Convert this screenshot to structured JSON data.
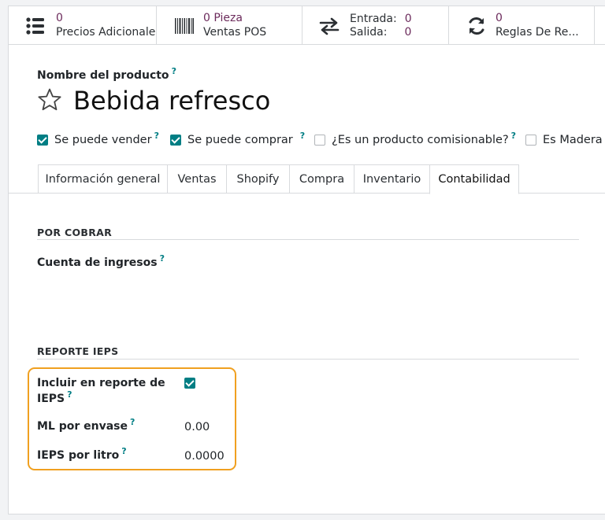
{
  "stat_buttons": [
    {
      "icon": "list-icon",
      "value": "0",
      "label": "Precios Adicionales"
    },
    {
      "icon": "barcode-icon",
      "value": "0 Pieza",
      "label": "Ventas POS"
    },
    {
      "icon": "transfer-arrows-icon",
      "row1_label": "Entrada:",
      "row1_value": "0",
      "row2_label": "Salida:",
      "row2_value": "0"
    },
    {
      "icon": "refresh-icon",
      "value": "0",
      "label": "Reglas De Re..."
    }
  ],
  "product": {
    "name_label": "Nombre del producto",
    "name": "Bebida refresco",
    "tooltip_mark": "?"
  },
  "flags": [
    {
      "label": "Se puede vender",
      "checked": true
    },
    {
      "label": "Se puede comprar",
      "checked": true
    },
    {
      "label": "¿Es un producto comisionable?",
      "checked": false
    },
    {
      "label": "Es Madera",
      "checked": false
    }
  ],
  "tabs": [
    {
      "label": "Información general",
      "active": false
    },
    {
      "label": "Ventas",
      "active": false
    },
    {
      "label": "Shopify",
      "active": false
    },
    {
      "label": "Compra",
      "active": false
    },
    {
      "label": "Inventario",
      "active": false
    },
    {
      "label": "Contabilidad",
      "active": true
    }
  ],
  "accounting": {
    "receivable_section": "POR COBRAR",
    "income_account_label": "Cuenta de ingresos",
    "ieps_section": "REPORTE IEPS",
    "include_label_line1": "Incluir en reporte de",
    "include_label_line2": "IEPS",
    "include_checked": true,
    "ml_label": "ML por envase",
    "ml_value": "0.00",
    "ieps_liter_label": "IEPS por litro",
    "ieps_liter_value": "0.0000"
  },
  "colors": {
    "accent": "#017e84",
    "stat_value": "#6b2a5b",
    "highlight": "#f0a020"
  }
}
